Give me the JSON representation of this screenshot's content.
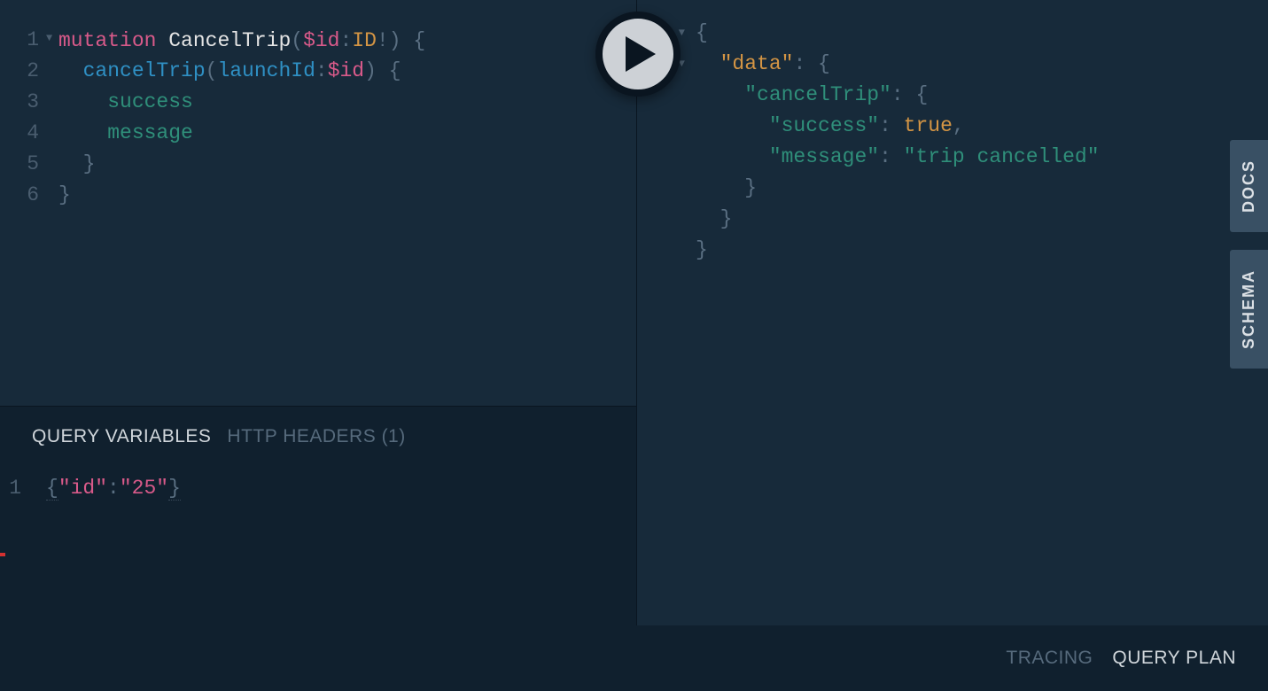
{
  "query": {
    "lines": [
      {
        "n": "1",
        "fold": true,
        "tokens": [
          {
            "t": "mutation",
            "c": "kw-mutation"
          },
          {
            "t": " ",
            "c": ""
          },
          {
            "t": "CancelTrip",
            "c": "kw-opname"
          },
          {
            "t": "(",
            "c": "kw-punct"
          },
          {
            "t": "$id",
            "c": "kw-var"
          },
          {
            "t": ":",
            "c": "kw-punct"
          },
          {
            "t": "ID",
            "c": "kw-typeid"
          },
          {
            "t": "!",
            "c": "kw-punct"
          },
          {
            "t": ")",
            "c": "kw-punct"
          },
          {
            "t": " ",
            "c": ""
          },
          {
            "t": "{",
            "c": "kw-brace"
          }
        ]
      },
      {
        "n": "2",
        "fold": false,
        "tokens": [
          {
            "t": "  ",
            "c": ""
          },
          {
            "t": "cancelTrip",
            "c": "kw-type"
          },
          {
            "t": "(",
            "c": "kw-punct"
          },
          {
            "t": "launchId",
            "c": "kw-arg"
          },
          {
            "t": ":",
            "c": "kw-punct"
          },
          {
            "t": "$id",
            "c": "kw-var"
          },
          {
            "t": ")",
            "c": "kw-punct"
          },
          {
            "t": " ",
            "c": ""
          },
          {
            "t": "{",
            "c": "kw-brace"
          }
        ]
      },
      {
        "n": "3",
        "fold": false,
        "tokens": [
          {
            "t": "    ",
            "c": ""
          },
          {
            "t": "success",
            "c": "kw-field"
          }
        ]
      },
      {
        "n": "4",
        "fold": false,
        "tokens": [
          {
            "t": "    ",
            "c": ""
          },
          {
            "t": "message",
            "c": "kw-field"
          }
        ]
      },
      {
        "n": "5",
        "fold": false,
        "tokens": [
          {
            "t": "  ",
            "c": ""
          },
          {
            "t": "}",
            "c": "kw-brace"
          }
        ]
      },
      {
        "n": "6",
        "fold": false,
        "tokens": [
          {
            "t": "}",
            "c": "kw-brace"
          }
        ]
      }
    ]
  },
  "tabs": {
    "query_variables": "QUERY VARIABLES",
    "http_headers": "HTTP HEADERS (1)"
  },
  "variables": {
    "line_number": "1",
    "tokens": [
      {
        "t": "{",
        "c": "var-brace"
      },
      {
        "t": "\"id\"",
        "c": "var-key"
      },
      {
        "t": ":",
        "c": "var-colon"
      },
      {
        "t": "\"25\"",
        "c": "var-val"
      },
      {
        "t": "}",
        "c": "var-brace"
      }
    ]
  },
  "response": {
    "lines": [
      {
        "fold": true,
        "indent": 0,
        "tokens": [
          {
            "t": "{",
            "c": "resp-brace"
          }
        ]
      },
      {
        "fold": true,
        "indent": 1,
        "tokens": [
          {
            "t": "\"data\"",
            "c": "resp-key-data"
          },
          {
            "t": ": ",
            "c": "resp-punct"
          },
          {
            "t": "{",
            "c": "resp-brace"
          }
        ]
      },
      {
        "fold": false,
        "indent": 2,
        "tokens": [
          {
            "t": "\"cancelTrip\"",
            "c": "resp-key"
          },
          {
            "t": ": ",
            "c": "resp-punct"
          },
          {
            "t": "{",
            "c": "resp-brace"
          }
        ]
      },
      {
        "fold": false,
        "indent": 3,
        "tokens": [
          {
            "t": "\"success\"",
            "c": "resp-key"
          },
          {
            "t": ": ",
            "c": "resp-punct"
          },
          {
            "t": "true",
            "c": "resp-true"
          },
          {
            "t": ",",
            "c": "resp-punct"
          }
        ]
      },
      {
        "fold": false,
        "indent": 3,
        "tokens": [
          {
            "t": "\"message\"",
            "c": "resp-key"
          },
          {
            "t": ": ",
            "c": "resp-punct"
          },
          {
            "t": "\"trip cancelled\"",
            "c": "resp-str"
          }
        ]
      },
      {
        "fold": false,
        "indent": 2,
        "tokens": [
          {
            "t": "}",
            "c": "resp-brace"
          }
        ]
      },
      {
        "fold": false,
        "indent": 1,
        "tokens": [
          {
            "t": "}",
            "c": "resp-brace"
          }
        ]
      },
      {
        "fold": false,
        "indent": 0,
        "tokens": [
          {
            "t": "}",
            "c": "resp-brace"
          }
        ]
      }
    ]
  },
  "side": {
    "docs": "DOCS",
    "schema": "SCHEMA"
  },
  "footer": {
    "tracing": "TRACING",
    "query_plan": "QUERY PLAN"
  }
}
